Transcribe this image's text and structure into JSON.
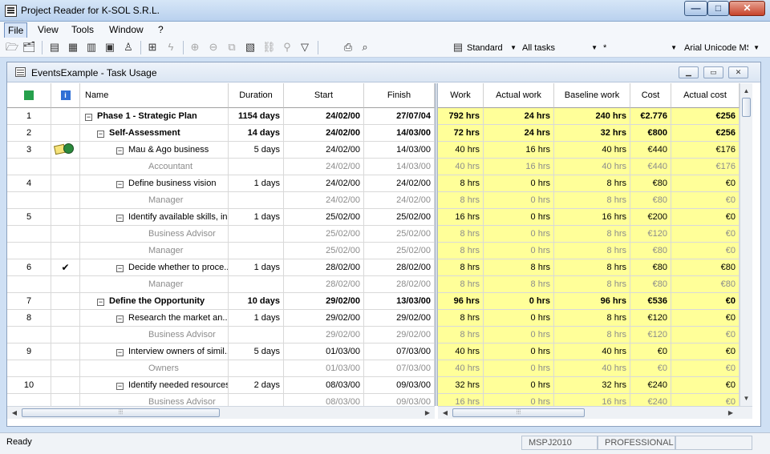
{
  "window": {
    "title": "Project Reader for K-SOL S.R.L.",
    "buttons": {
      "min": "—",
      "max": "□",
      "close": "✕"
    }
  },
  "menu": [
    "File",
    "View",
    "Tools",
    "Window",
    "?"
  ],
  "toolbar": {
    "view_combo": "Standard",
    "filter_combo": "All tasks",
    "group_combo": "*",
    "font_combo": "Arial Unicode MS"
  },
  "child": {
    "title": "EventsExample - Task Usage"
  },
  "left_columns": [
    "",
    "",
    "Name",
    "Duration",
    "Start",
    "Finish"
  ],
  "right_columns": [
    "Work",
    "Actual work",
    "Baseline work",
    "Cost",
    "Actual cost"
  ],
  "rows": [
    {
      "id": "1",
      "ind": "",
      "name": "Phase 1 - Strategic Plan",
      "level": 0,
      "expand": true,
      "kind": "summary",
      "duration": "1154 days",
      "start": "24/02/00",
      "finish": "27/07/04",
      "work": "792 hrs",
      "actual_work": "24 hrs",
      "baseline_work": "240 hrs",
      "cost": "€2.776",
      "actual_cost": "€256"
    },
    {
      "id": "2",
      "ind": "",
      "name": "Self-Assessment",
      "level": 1,
      "expand": true,
      "kind": "summary",
      "duration": "14 days",
      "start": "24/02/00",
      "finish": "14/03/00",
      "work": "72 hrs",
      "actual_work": "24 hrs",
      "baseline_work": "32 hrs",
      "cost": "€800",
      "actual_cost": "€256"
    },
    {
      "id": "3",
      "ind": "icons",
      "name": "Mau & Ago business",
      "level": 2,
      "expand": true,
      "kind": "task",
      "duration": "5 days",
      "start": "24/02/00",
      "finish": "14/03/00",
      "work": "40 hrs",
      "actual_work": "16 hrs",
      "baseline_work": "40 hrs",
      "cost": "€440",
      "actual_cost": "€176"
    },
    {
      "id": "",
      "ind": "",
      "name": "Accountant",
      "level": 3,
      "expand": false,
      "kind": "assignment",
      "duration": "",
      "start": "24/02/00",
      "finish": "14/03/00",
      "work": "40 hrs",
      "actual_work": "16 hrs",
      "baseline_work": "40 hrs",
      "cost": "€440",
      "actual_cost": "€176"
    },
    {
      "id": "4",
      "ind": "",
      "name": "Define business vision",
      "level": 2,
      "expand": true,
      "kind": "task",
      "duration": "1 days",
      "start": "24/02/00",
      "finish": "24/02/00",
      "work": "8 hrs",
      "actual_work": "0 hrs",
      "baseline_work": "8 hrs",
      "cost": "€80",
      "actual_cost": "€0"
    },
    {
      "id": "",
      "ind": "",
      "name": "Manager",
      "level": 3,
      "expand": false,
      "kind": "assignment",
      "duration": "",
      "start": "24/02/00",
      "finish": "24/02/00",
      "work": "8 hrs",
      "actual_work": "0 hrs",
      "baseline_work": "8 hrs",
      "cost": "€80",
      "actual_cost": "€0"
    },
    {
      "id": "5",
      "ind": "",
      "name": "Identify available skills, in...",
      "level": 2,
      "expand": true,
      "kind": "task",
      "duration": "1 days",
      "start": "25/02/00",
      "finish": "25/02/00",
      "work": "16 hrs",
      "actual_work": "0 hrs",
      "baseline_work": "16 hrs",
      "cost": "€200",
      "actual_cost": "€0"
    },
    {
      "id": "",
      "ind": "",
      "name": "Business Advisor",
      "level": 3,
      "expand": false,
      "kind": "assignment",
      "duration": "",
      "start": "25/02/00",
      "finish": "25/02/00",
      "work": "8 hrs",
      "actual_work": "0 hrs",
      "baseline_work": "8 hrs",
      "cost": "€120",
      "actual_cost": "€0"
    },
    {
      "id": "",
      "ind": "",
      "name": "Manager",
      "level": 3,
      "expand": false,
      "kind": "assignment",
      "duration": "",
      "start": "25/02/00",
      "finish": "25/02/00",
      "work": "8 hrs",
      "actual_work": "0 hrs",
      "baseline_work": "8 hrs",
      "cost": "€80",
      "actual_cost": "€0"
    },
    {
      "id": "6",
      "ind": "check",
      "name": "Decide whether to proce...",
      "level": 2,
      "expand": true,
      "kind": "task",
      "duration": "1 days",
      "start": "28/02/00",
      "finish": "28/02/00",
      "work": "8 hrs",
      "actual_work": "8 hrs",
      "baseline_work": "8 hrs",
      "cost": "€80",
      "actual_cost": "€80"
    },
    {
      "id": "",
      "ind": "",
      "name": "Manager",
      "level": 3,
      "expand": false,
      "kind": "assignment",
      "duration": "",
      "start": "28/02/00",
      "finish": "28/02/00",
      "work": "8 hrs",
      "actual_work": "8 hrs",
      "baseline_work": "8 hrs",
      "cost": "€80",
      "actual_cost": "€80"
    },
    {
      "id": "7",
      "ind": "",
      "name": "Define the Opportunity",
      "level": 1,
      "expand": true,
      "kind": "summary",
      "duration": "10 days",
      "start": "29/02/00",
      "finish": "13/03/00",
      "work": "96 hrs",
      "actual_work": "0 hrs",
      "baseline_work": "96 hrs",
      "cost": "€536",
      "actual_cost": "€0"
    },
    {
      "id": "8",
      "ind": "",
      "name": "Research the market an...",
      "level": 2,
      "expand": true,
      "kind": "task",
      "duration": "1 days",
      "start": "29/02/00",
      "finish": "29/02/00",
      "work": "8 hrs",
      "actual_work": "0 hrs",
      "baseline_work": "8 hrs",
      "cost": "€120",
      "actual_cost": "€0"
    },
    {
      "id": "",
      "ind": "",
      "name": "Business Advisor",
      "level": 3,
      "expand": false,
      "kind": "assignment",
      "duration": "",
      "start": "29/02/00",
      "finish": "29/02/00",
      "work": "8 hrs",
      "actual_work": "0 hrs",
      "baseline_work": "8 hrs",
      "cost": "€120",
      "actual_cost": "€0"
    },
    {
      "id": "9",
      "ind": "",
      "name": "Interview owners of simil...",
      "level": 2,
      "expand": true,
      "kind": "task",
      "duration": "5 days",
      "start": "01/03/00",
      "finish": "07/03/00",
      "work": "40 hrs",
      "actual_work": "0 hrs",
      "baseline_work": "40 hrs",
      "cost": "€0",
      "actual_cost": "€0"
    },
    {
      "id": "",
      "ind": "",
      "name": "Owners",
      "level": 3,
      "expand": false,
      "kind": "assignment",
      "duration": "",
      "start": "01/03/00",
      "finish": "07/03/00",
      "work": "40 hrs",
      "actual_work": "0 hrs",
      "baseline_work": "40 hrs",
      "cost": "€0",
      "actual_cost": "€0"
    },
    {
      "id": "10",
      "ind": "",
      "name": "Identify needed resources",
      "level": 2,
      "expand": true,
      "kind": "task",
      "duration": "2 days",
      "start": "08/03/00",
      "finish": "09/03/00",
      "work": "32 hrs",
      "actual_work": "0 hrs",
      "baseline_work": "32 hrs",
      "cost": "€240",
      "actual_cost": "€0"
    },
    {
      "id": "",
      "ind": "",
      "name": "Business Advisor",
      "level": 3,
      "expand": false,
      "kind": "assignment",
      "duration": "",
      "start": "08/03/00",
      "finish": "09/03/00",
      "work": "16 hrs",
      "actual_work": "0 hrs",
      "baseline_work": "16 hrs",
      "cost": "€240",
      "actual_cost": "€0"
    }
  ],
  "status": {
    "text": "Ready",
    "panel1": "MSPJ2010",
    "panel2": "PROFESSIONAL"
  },
  "colors": {
    "highlight": "#ffff99"
  }
}
